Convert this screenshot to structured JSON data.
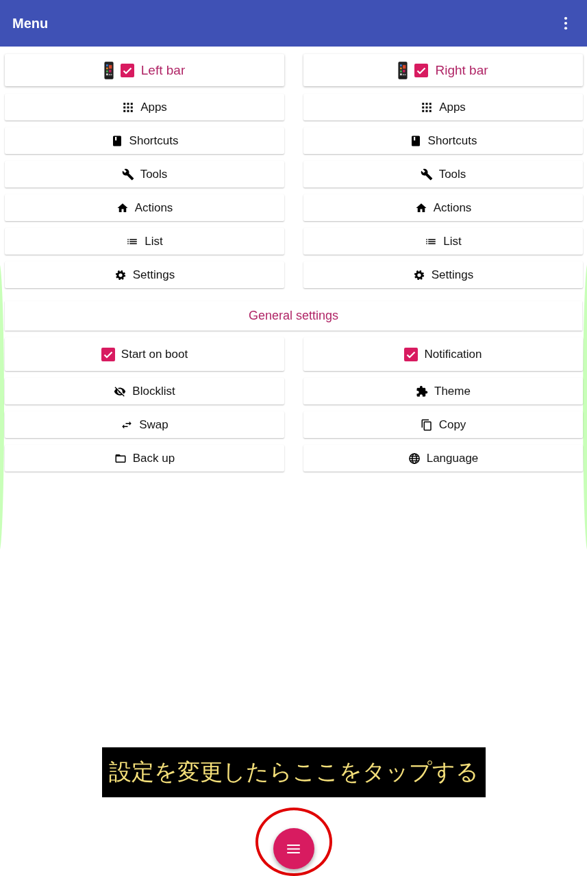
{
  "app_bar": {
    "title": "Menu"
  },
  "columns": [
    {
      "header": {
        "label": "Left bar",
        "checked": true
      },
      "items": [
        {
          "label": "Apps"
        },
        {
          "label": "Shortcuts"
        },
        {
          "label": "Tools"
        },
        {
          "label": "Actions"
        },
        {
          "label": "List"
        },
        {
          "label": "Settings"
        }
      ]
    },
    {
      "header": {
        "label": "Right bar",
        "checked": true
      },
      "items": [
        {
          "label": "Apps"
        },
        {
          "label": "Shortcuts"
        },
        {
          "label": "Tools"
        },
        {
          "label": "Actions"
        },
        {
          "label": "List"
        },
        {
          "label": "Settings"
        }
      ]
    }
  ],
  "general": {
    "title": "General settings",
    "items": [
      {
        "kind": "checkbox",
        "label": "Start on boot",
        "checked": true
      },
      {
        "kind": "checkbox",
        "label": "Notification",
        "checked": true
      },
      {
        "kind": "icon",
        "label": "Blocklist"
      },
      {
        "kind": "icon",
        "label": "Theme"
      },
      {
        "kind": "icon",
        "label": "Swap"
      },
      {
        "kind": "icon",
        "label": "Copy"
      },
      {
        "kind": "icon",
        "label": "Back up"
      },
      {
        "kind": "icon",
        "label": "Language"
      }
    ]
  },
  "annotation": {
    "text": "設定を変更したらここをタップする"
  }
}
